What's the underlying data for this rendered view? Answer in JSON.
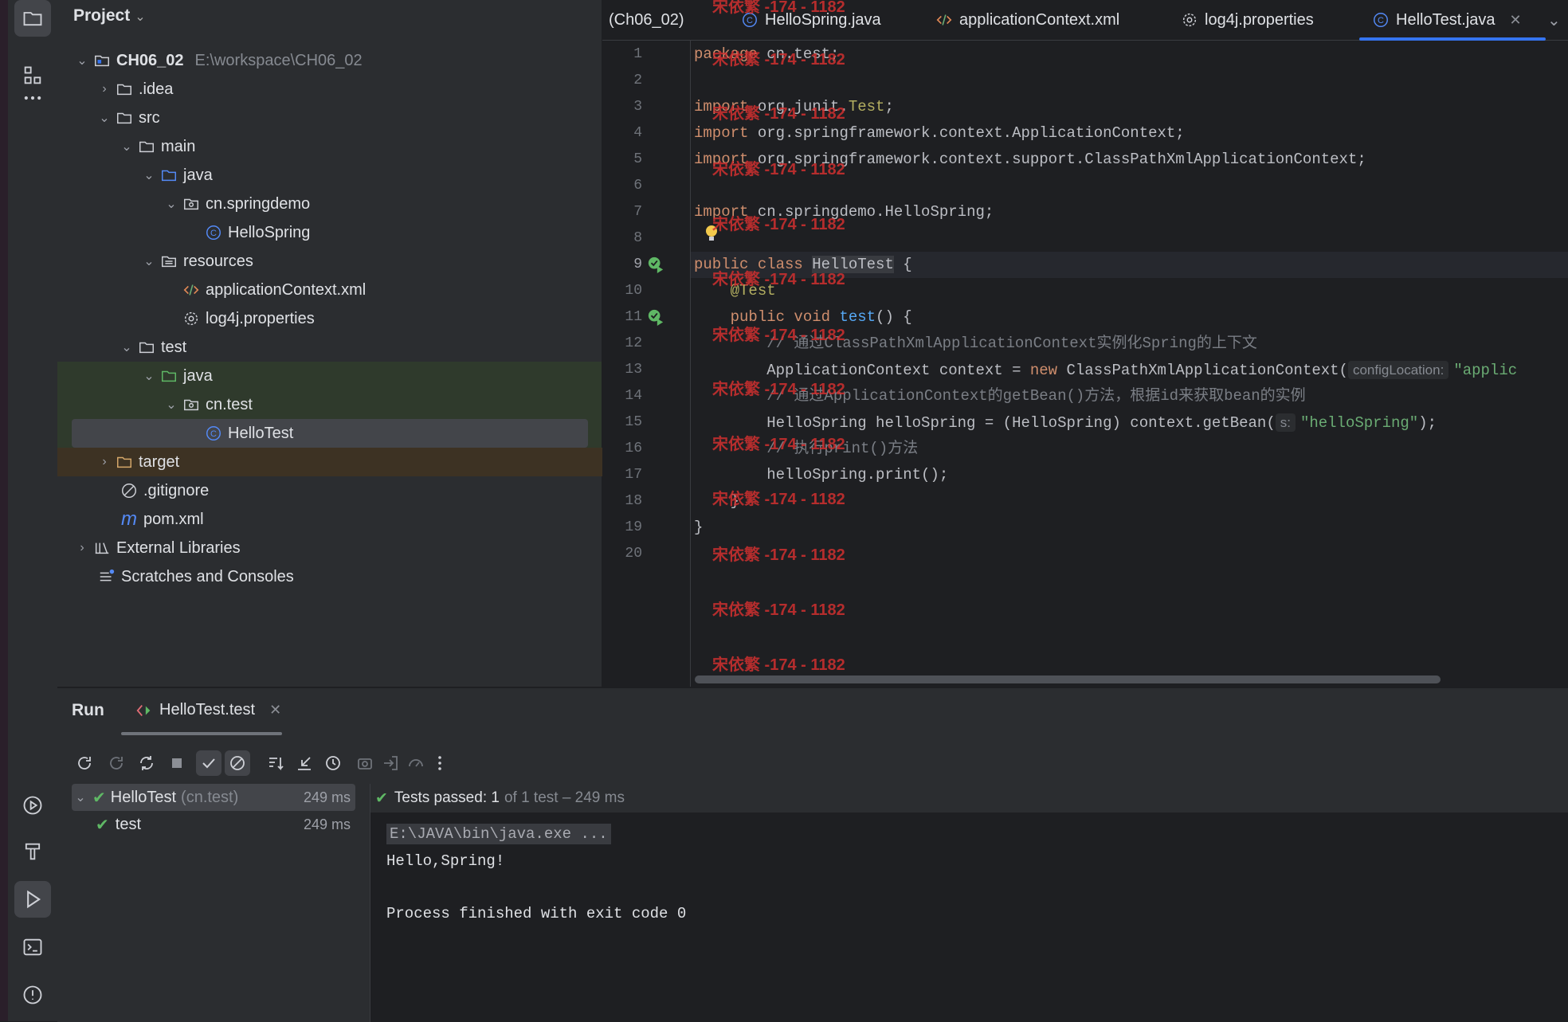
{
  "project": {
    "title": "Project",
    "tree": [
      {
        "label": "CH06_02",
        "sub": "E:\\workspace\\CH06_02",
        "icon": "module-folder-icon"
      },
      {
        "label": ".idea",
        "icon": "folder-icon"
      },
      {
        "label": "src",
        "icon": "folder-icon"
      },
      {
        "label": "main",
        "icon": "folder-icon"
      },
      {
        "label": "java",
        "icon": "source-folder-icon"
      },
      {
        "label": "cn.springdemo",
        "icon": "package-icon"
      },
      {
        "label": "HelloSpring",
        "icon": "class-icon"
      },
      {
        "label": "resources",
        "icon": "resources-folder-icon"
      },
      {
        "label": "applicationContext.xml",
        "icon": "xml-icon"
      },
      {
        "label": "log4j.properties",
        "icon": "gear-icon"
      },
      {
        "label": "test",
        "icon": "folder-icon"
      },
      {
        "label": "java",
        "icon": "test-folder-icon"
      },
      {
        "label": "cn.test",
        "icon": "package-icon"
      },
      {
        "label": "HelloTest",
        "icon": "class-icon"
      },
      {
        "label": "target",
        "icon": "folder-icon"
      },
      {
        "label": ".gitignore",
        "icon": "ignore-icon"
      },
      {
        "label": "pom.xml",
        "icon": "maven-icon"
      },
      {
        "label": "External Libraries",
        "icon": "library-icon"
      },
      {
        "label": "Scratches and Consoles",
        "icon": "scratches-icon"
      }
    ]
  },
  "tabs": [
    {
      "label": "(Ch06_02)"
    },
    {
      "label": "HelloSpring.java",
      "icon": "class-icon"
    },
    {
      "label": "applicationContext.xml",
      "icon": "xml-icon"
    },
    {
      "label": "log4j.properties",
      "icon": "gear-icon"
    },
    {
      "label": "HelloTest.java",
      "icon": "class-icon",
      "active": true
    }
  ],
  "editor": {
    "line_numbers": [
      "1",
      "2",
      "3",
      "4",
      "5",
      "6",
      "7",
      "8",
      "9",
      "10",
      "11",
      "12",
      "13",
      "14",
      "15",
      "16",
      "17",
      "18",
      "19",
      "20"
    ],
    "current_line": 9,
    "code": {
      "l1_kw": "package",
      "l1_rest": " cn.test;",
      "l3_kw": "import",
      "l3_rest": " org.junit.",
      "l3_cls": "Test",
      "l3_end": ";",
      "l4_kw": "import",
      "l4_rest": " org.springframework.context.ApplicationContext;",
      "l5_kw": "import",
      "l5_rest": " org.springframework.context.support.ClassPathXmlApplicationContext;",
      "l7_kw": "import",
      "l7_rest": " cn.springdemo.HelloSpring;",
      "l9_kw": "public class ",
      "l9_cls": "HelloTest",
      "l9_rest": " {",
      "l10_an": "    @Test",
      "l11_kw": "    public void ",
      "l11_fn": "test",
      "l11_rest": "() {",
      "l12_cm": "        // 通过ClassPathXmlApplicationContext实例化Spring的上下文",
      "l13_a": "        ApplicationContext context = ",
      "l13_kw": "new",
      "l13_b": " ClassPathXmlApplicationContext(",
      "l13_hint": "configLocation:",
      "l13_str": "\"applic",
      "l14_cm": "        // 通过ApplicationContext的getBean()方法，根据id来获取bean的实例",
      "l15_a": "        HelloSpring helloSpring = (HelloSpring) context.getBean(",
      "l15_hint": "s:",
      "l15_str": "\"helloSpring\"",
      "l15_end": ");",
      "l16_cm": "        // 执行print()方法",
      "l17": "        helloSpring.print();",
      "l18": "    }",
      "l19": "}"
    }
  },
  "watermark": "宋依繁 -174 - 1182",
  "run": {
    "title": "Run",
    "tab_label": "HelloTest.test",
    "tests": [
      {
        "name": "HelloTest",
        "sub": "(cn.test)",
        "time": "249 ms"
      },
      {
        "name": "test",
        "time": "249 ms"
      }
    ],
    "status_prefix": "Tests passed: 1",
    "status_suffix": "of 1 test – 249 ms",
    "console": {
      "cmd": "E:\\JAVA\\bin\\java.exe ...",
      "out1": "Hello,Spring!",
      "out2": "Process finished with exit code 0"
    }
  },
  "colors": {
    "accent": "#3574f0",
    "pass": "#5fb865",
    "watermark": "#d03030"
  }
}
